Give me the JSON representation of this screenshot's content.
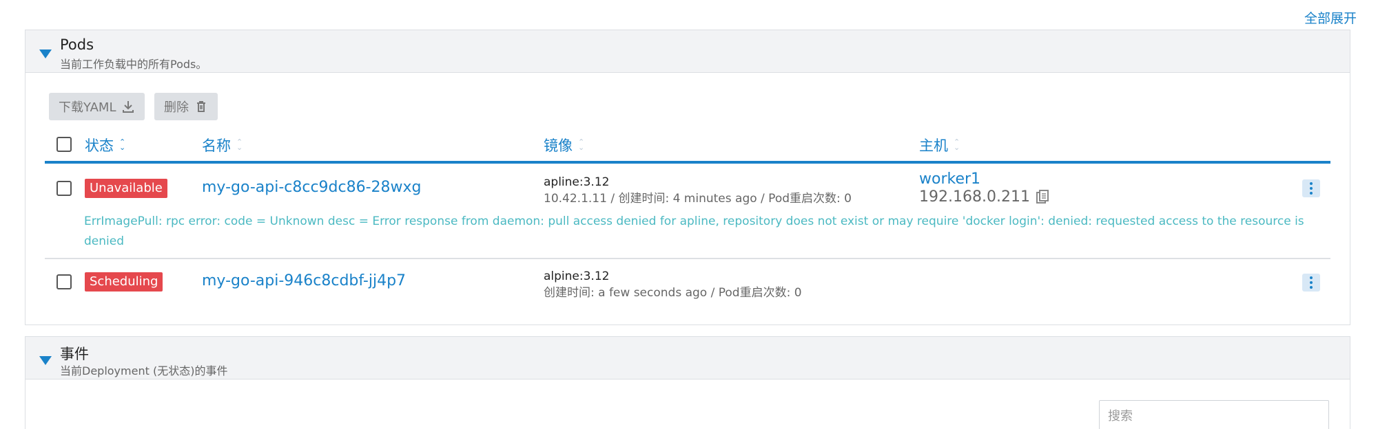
{
  "top": {
    "expand_all": "全部展开"
  },
  "pods": {
    "title": "Pods",
    "subtitle": "当前工作负载中的所有Pods。",
    "buttons": {
      "download": "下载YAML",
      "delete": "删除"
    },
    "columns": {
      "status": "状态",
      "name": "名称",
      "image": "镜像",
      "host": "主机"
    },
    "rows": [
      {
        "status": "Unavailable",
        "name": "my-go-api-c8cc9dc86-28wxg",
        "image": "apline:3.12",
        "meta": "10.42.1.11 / 创建时间: 4 minutes ago / Pod重启次数: 0",
        "host": "worker1",
        "ip": "192.168.0.211",
        "error": "ErrImagePull: rpc error: code = Unknown desc = Error response from daemon: pull access denied for apline, repository does not exist or may require 'docker login': denied: requested access to the resource is denied"
      },
      {
        "status": "Scheduling",
        "name": "my-go-api-946c8cdbf-jj4p7",
        "image": "alpine:3.12",
        "meta": "创建时间: a few seconds ago / Pod重启次数: 0"
      }
    ]
  },
  "events": {
    "title": "事件",
    "subtitle": "当前Deployment (无状态)的事件",
    "search_placeholder": "搜索"
  },
  "colors": {
    "accent": "#1a82c9",
    "danger": "#e5484d",
    "error_text": "#4bb9c2"
  }
}
